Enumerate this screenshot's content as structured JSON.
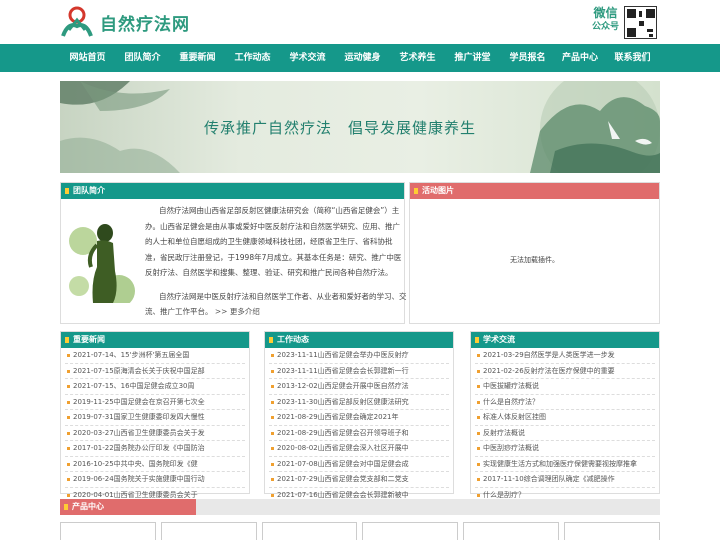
{
  "header": {
    "logo_text": "自然疗法网",
    "wechat_line1": "微信",
    "wechat_line2": "公众号",
    "brand_color": "#15988a"
  },
  "nav": [
    "网站首页",
    "团队简介",
    "重要新闻",
    "工作动态",
    "学术交流",
    "运动健身",
    "艺术养生",
    "推广讲堂",
    "学员报名",
    "产品中心",
    "联系我们"
  ],
  "banner": {
    "slogan": "传承推广自然疗法　倡导发展健康养生"
  },
  "intro": {
    "title": "团队简介",
    "para1": "自然疗法网由山西省足部反射区健康法研究会（简称“山西省足健会”）主办。山西省足健会是由从事或爱好中医反射疗法和自然医学研究、应用、推广的人士和单位自愿组成的卫生健康领域科技社团，经原省卫生厅、省科协批准，省民政厅注册登记，于1998年7月成立。其基本任务是：研究、推广中医反射疗法、自然医学和搜集、整理、验证、研究和推广民间各种自然疗法。",
    "para2": "自然疗法网是中医反射疗法和自然医学工作者、从业者和爱好者的学习、交流、推广工作平台。",
    "more": ">> 更多介绍"
  },
  "activity": {
    "title": "活动图片",
    "message": "无法加载插件。"
  },
  "news": {
    "title": "重要新闻",
    "items": [
      "2021-07-14、15'步洲杯'第五届全国",
      "2021-07-15原海清会长关于庆祝中国足部",
      "2021-07-15、16中国足健会成立30周",
      "2019-11-25中国足健会在京召开第七次全",
      "2019-07-31国家卫生健康委印发四大慢性",
      "2020-03-27山西省卫生健康委员会关于发",
      "2017-01-22国务院办公厅印发《中国防治",
      "2016-10-25中共中央、国务院印发《健",
      "2019-06-24国务院关于实施健康中国行动",
      "2020-04-01山西省卫生健康委员会关于"
    ]
  },
  "work": {
    "title": "工作动态",
    "items": [
      "2023-11-11山西省足健会举办中医反射疗",
      "2023-11-11山西省足健会会长郭建新一行",
      "2013-12-02山西足健会开展中医自然疗法",
      "2023-11-30山西省足部反射区健康法研究",
      "2021-08-29山西省足健会确定2021年",
      "2021-08-29山西省足健会召开领导班子和",
      "2020-08-02山西省足健会深入社区开展中",
      "2021-07-08山西省足健会对中国足健会成",
      "2021-07-29山西省足健会党支部和二党支",
      "2021-07-16山西省足健会会长郭建新被中"
    ]
  },
  "academic": {
    "title": "学术交流",
    "items": [
      "2021-03-29自然医学是人类医学进一步发",
      "2021-02-26反射疗法在医疗保健中的重要",
      "中医拔罐疗法概说",
      "什么是自然疗法？",
      "标准人体反射区挂图",
      "反射疗法概说",
      "中医刮痧疗法概说",
      "实现健康生活方式和加强医疗保健需要视按摩推拿",
      "2017-11-10综合调理团队确定《减肥操作",
      "什么是刮疗？"
    ]
  },
  "products": {
    "title": "产品中心"
  }
}
